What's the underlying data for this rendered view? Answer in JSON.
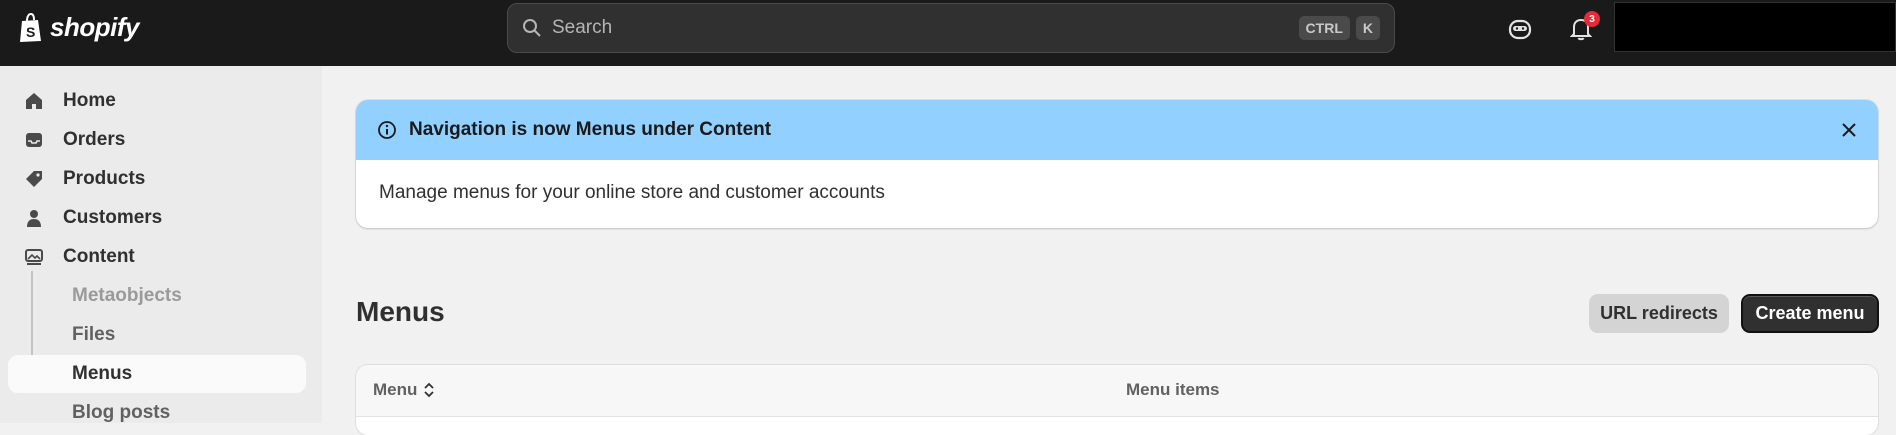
{
  "topbar": {
    "logo_text": "shopify",
    "search": {
      "placeholder": "Search",
      "shortcut_keys": [
        "CTRL",
        "K"
      ]
    },
    "notifications_count": "3"
  },
  "sidebar": {
    "items": [
      {
        "label": "Home",
        "icon": "home-icon"
      },
      {
        "label": "Orders",
        "icon": "inbox-icon"
      },
      {
        "label": "Products",
        "icon": "tag-icon"
      },
      {
        "label": "Customers",
        "icon": "person-icon"
      },
      {
        "label": "Content",
        "icon": "image-icon"
      }
    ],
    "sub_items": [
      {
        "label": "Metaobjects"
      },
      {
        "label": "Files"
      },
      {
        "label": "Menus",
        "active": true
      },
      {
        "label": "Blog posts"
      }
    ]
  },
  "banner": {
    "title": "Navigation is now Menus under Content",
    "body": "Manage menus for your online store and customer accounts"
  },
  "page": {
    "title": "Menus",
    "secondary_button": "URL redirects",
    "primary_button": "Create menu"
  },
  "table": {
    "columns": [
      "Menu",
      "Menu items"
    ]
  },
  "colors": {
    "topbar_bg": "#1a1a1a",
    "banner_header": "#91d0ff",
    "badge": "#e22c38",
    "primary_button": "#303030"
  }
}
